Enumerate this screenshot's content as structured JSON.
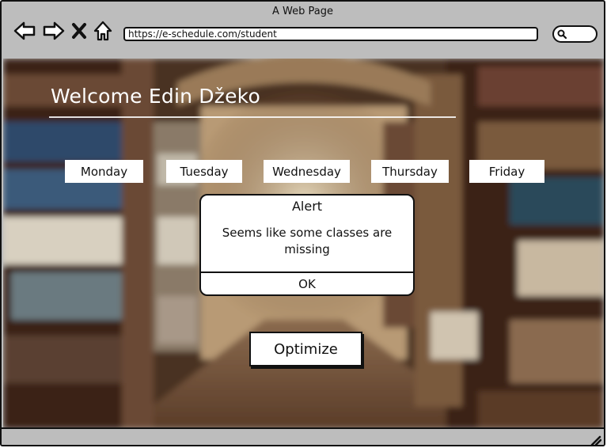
{
  "window": {
    "title": "A Web Page"
  },
  "browser": {
    "url": "https://e-schedule.com/student",
    "icons": [
      "back-arrow-icon",
      "forward-arrow-icon",
      "close-x-icon",
      "home-icon",
      "search-icon",
      "resize-grip-icon"
    ]
  },
  "page": {
    "welcome": "Welcome Edin Džeko",
    "days": [
      "Monday",
      "Tuesday",
      "Wednesday",
      "Thursday",
      "Friday"
    ],
    "optimize_label": "Optimize"
  },
  "alert": {
    "title": "Alert",
    "message": "Seems like some classes are missing",
    "ok_label": "OK"
  },
  "colors": {
    "chrome": "#bdbdbd",
    "outline": "#111111",
    "panel": "#ffffff"
  }
}
